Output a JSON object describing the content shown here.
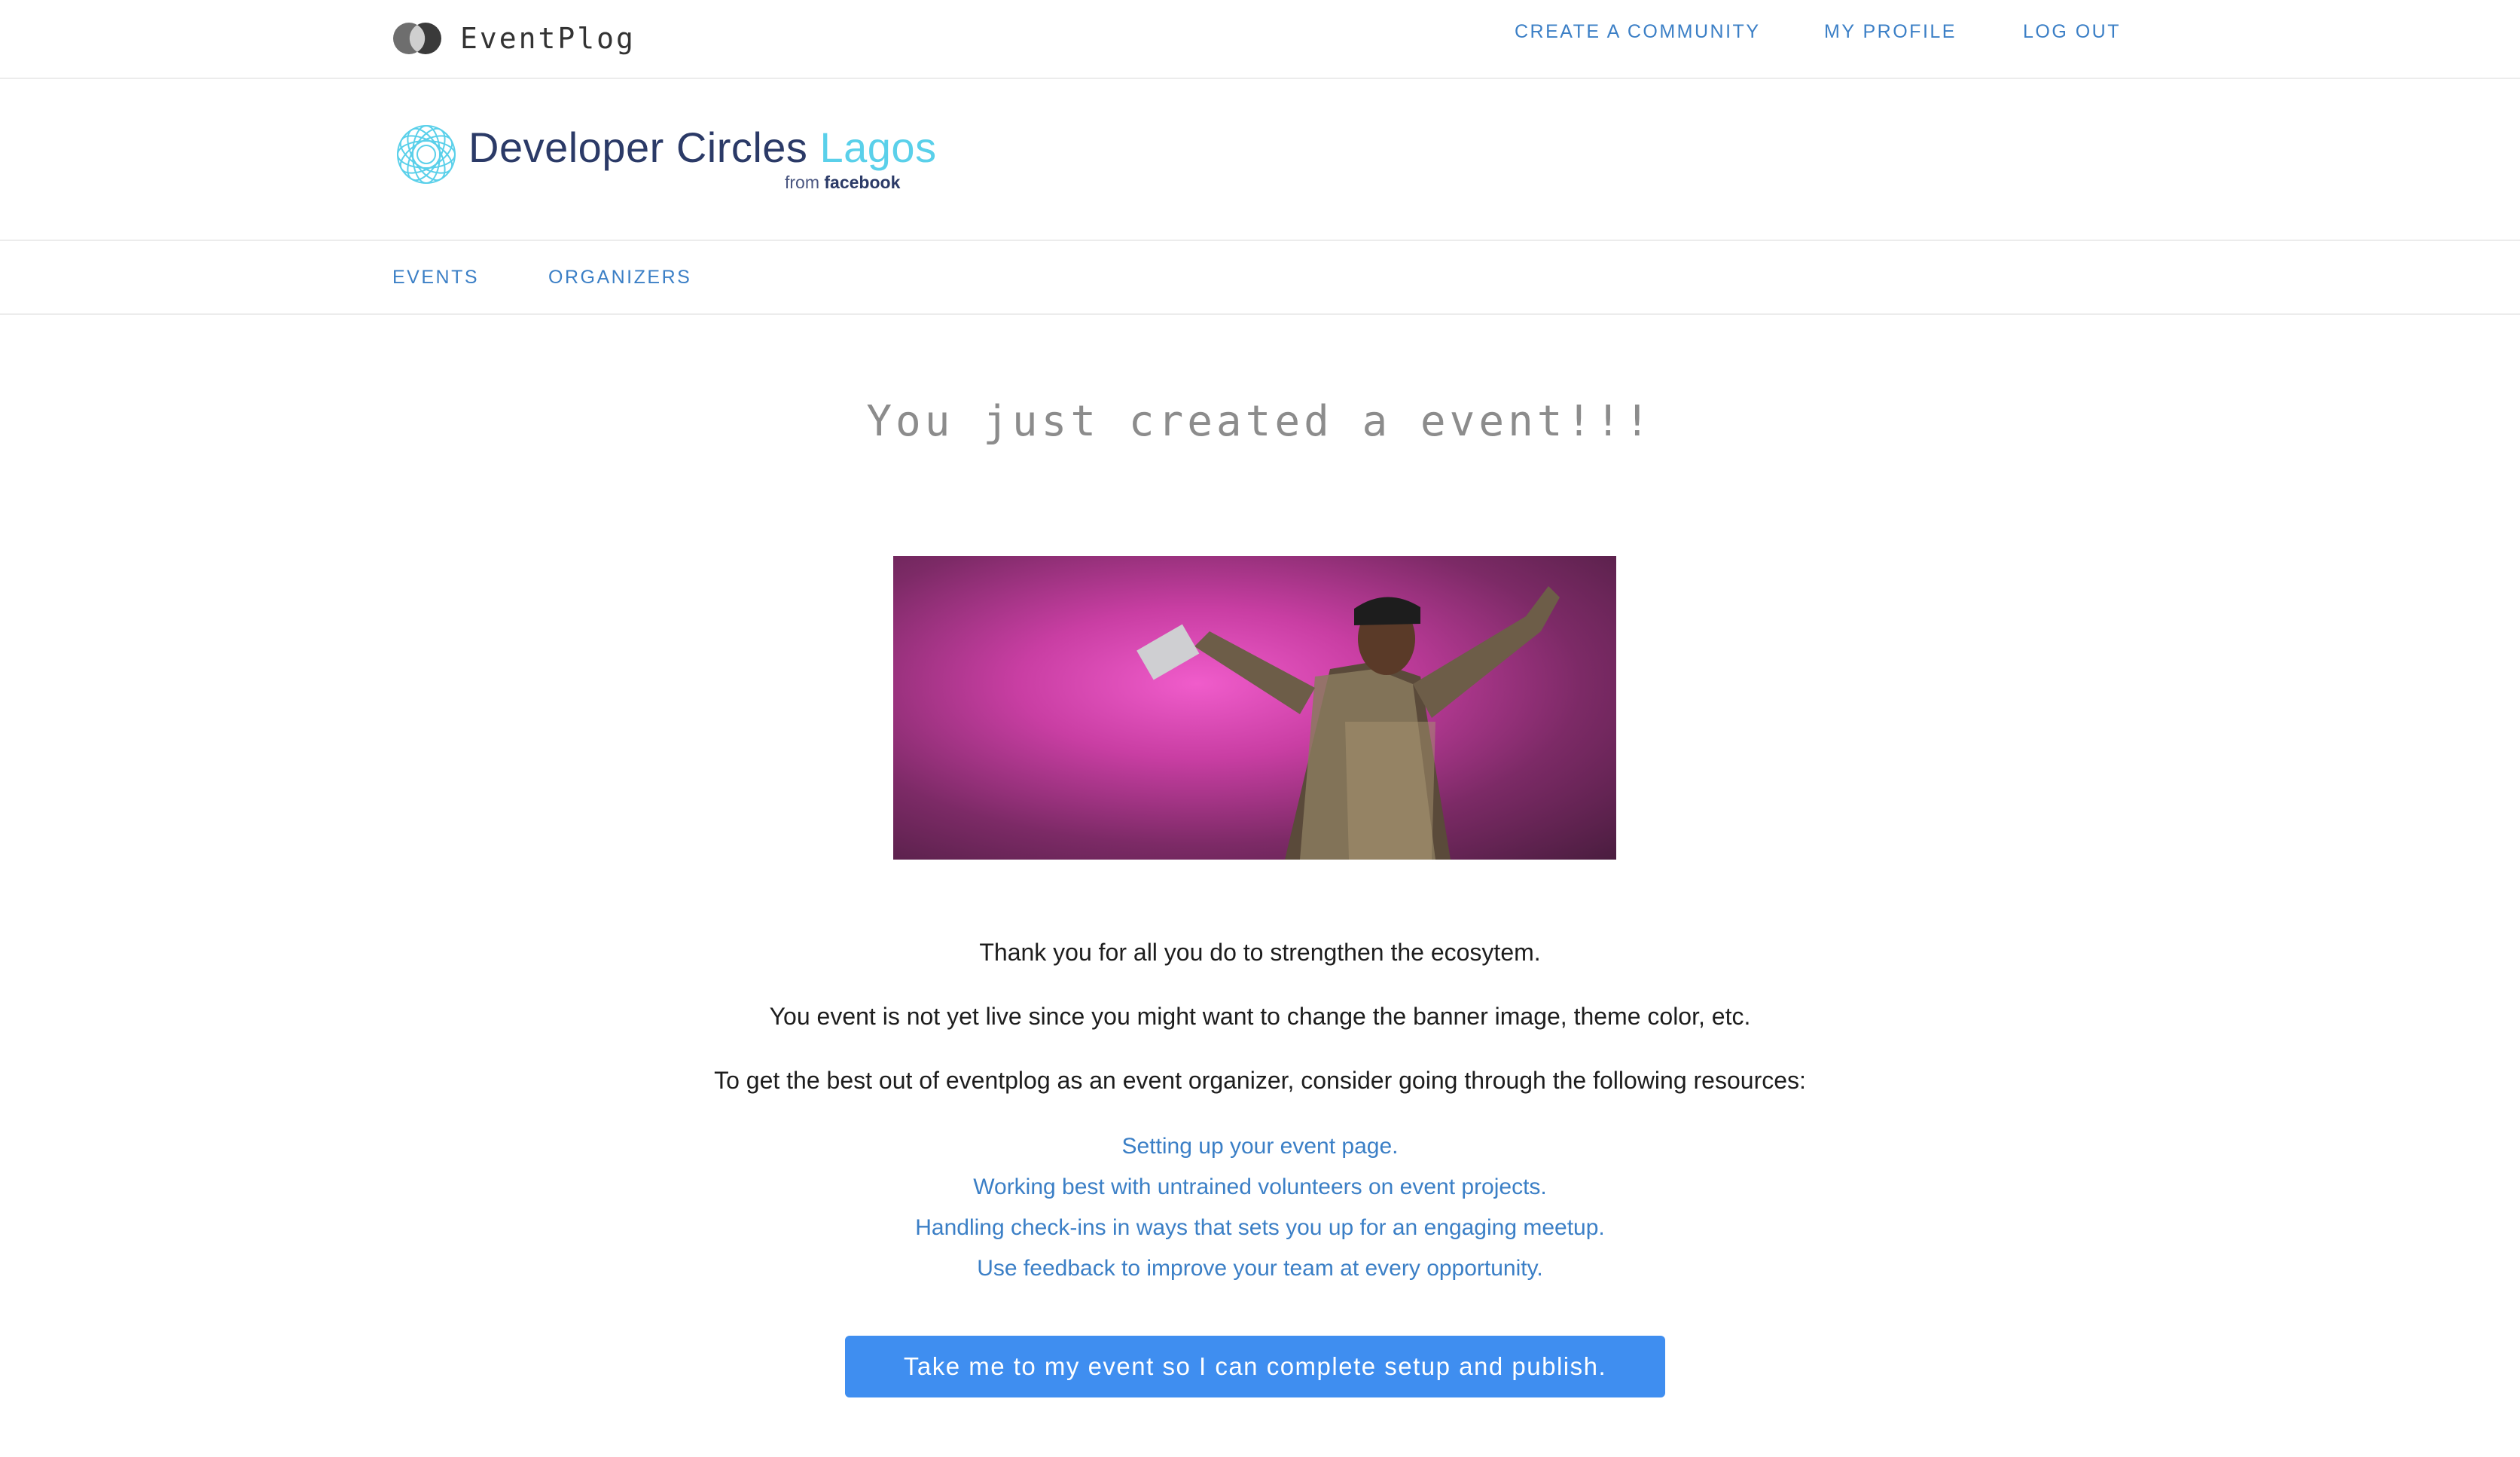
{
  "app": {
    "name": "EventPlog"
  },
  "topnav": {
    "create_community": "CREATE A COMMUNITY",
    "my_profile": "MY PROFILE",
    "log_out": "LOG OUT"
  },
  "community": {
    "title_main": "Developer Circles",
    "title_city": "Lagos",
    "from_label": "from",
    "from_brand": "facebook"
  },
  "subnav": {
    "events": "EVENTS",
    "organizers": "ORGANIZERS"
  },
  "main": {
    "headline": "You just created a event!!!",
    "thanks": "Thank you for all you do to strengthen the ecosytem.",
    "not_live": "You event is not yet live since you might want to change the banner image, theme color, etc.",
    "resources_intro": "To get the best out of eventplog as an event organizer, consider going through the following resources:",
    "resources": [
      "Setting up your event page.",
      "Working best with untrained volunteers on event projects.",
      "Handling check-ins in ways that sets you up for an engaging meetup.",
      "Use feedback to improve your team at every opportunity."
    ],
    "cta_label": "Take me to my event so I can complete setup and publish."
  },
  "colors": {
    "link": "#3b7fc6",
    "cta_background": "#3f8ef0",
    "headline": "#8c8c8c",
    "community_title": "#2b3a67",
    "community_city": "#5ad0ea"
  },
  "icons": {
    "brand_logo": "overlapping-circles-icon",
    "community_logo": "developer-circles-icon"
  }
}
